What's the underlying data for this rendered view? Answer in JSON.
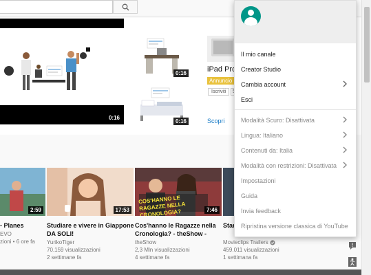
{
  "search": {
    "placeholder": ""
  },
  "ad": {
    "main_duration": "0:16",
    "thumb1_duration": "0:16",
    "thumb2_duration": "0:16",
    "title": "iPad Pro",
    "badge": "Annuncio",
    "subscribe": "Iscriviti",
    "subscribe_count": "5",
    "discover": "Scopri"
  },
  "videos": [
    {
      "title1": "- Planes",
      "title2": "",
      "channel": "EVO",
      "views": "zioni • 6 ore fa",
      "ago": "",
      "duration": "2:59",
      "bg": "#6aa9c9"
    },
    {
      "title1": "Studiare e vivere in Giappone",
      "title2": "DA SOLI!",
      "channel": "YurikoTiger",
      "views": "70.159 visualizzazioni",
      "ago": "2 settimane fa",
      "duration": "17:53",
      "bg": "#f3d2b8"
    },
    {
      "title1": "Cos'hanno le Ragazze nella",
      "title2": "Cronologia? - theShow -",
      "channel": "theShow",
      "views": "2,3 Mln visualizzazioni",
      "ago": "4 settimane fa",
      "duration": "7:46",
      "bg": "#b33a3a",
      "overlay": "COS'HANNO LE RAGAZZE NELLA CRONOLOGIA?"
    },
    {
      "title1": "Star",
      "title2": "",
      "channel": "Movieclips Trailers",
      "views": "459.011 visualizzazioni",
      "ago": "1 settimana fa",
      "duration": "",
      "bg": "#3c4a5a"
    }
  ],
  "menu": {
    "items_top": [
      {
        "label": "Il mio canale",
        "chevron": false
      },
      {
        "label": "Creator Studio",
        "chevron": false
      },
      {
        "label": "Cambia account",
        "chevron": true
      },
      {
        "label": "Esci",
        "chevron": false
      }
    ],
    "items_bottom": [
      {
        "label": "Modalità Scuro: Disattivata",
        "chevron": true
      },
      {
        "label": "Lingua: Italiano",
        "chevron": true
      },
      {
        "label": "Contenuti da: Italia",
        "chevron": true
      },
      {
        "label": "Modalità con restrizioni: Disattivata",
        "chevron": true
      },
      {
        "label": "Impostazioni",
        "chevron": false
      },
      {
        "label": "Guida",
        "chevron": false
      },
      {
        "label": "Invia feedback",
        "chevron": false
      },
      {
        "label": "Ripristina versione classica di YouTube",
        "chevron": false
      }
    ]
  },
  "colors": {
    "avatar": "#009688",
    "link": "#167ac6",
    "badge": "#e9c23d"
  }
}
